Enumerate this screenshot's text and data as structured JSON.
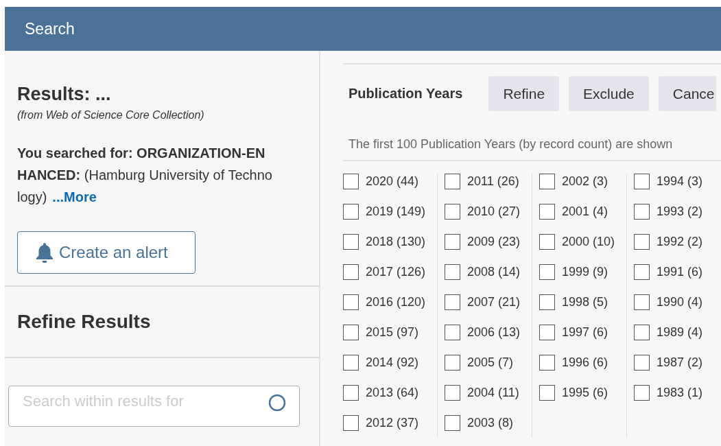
{
  "header": {
    "title": "Search"
  },
  "results": {
    "title": "Results: ...",
    "source": "(from Web of Science Core Collection)",
    "query": "**You searched for: ORGANIZATION-ENHANCED:** (Hamburg University of Technology)",
    "more_link": "...More",
    "alert_button": "Create an alert"
  },
  "refine": {
    "title": "Refine Results",
    "search_placeholder": "Search within results for"
  },
  "facet": {
    "title": "Publication Years",
    "buttons": [
      "Refine",
      "Exclude",
      "Cance"
    ],
    "info": "The first 100 Publication Years (by record count) are shown",
    "columns": [
      [
        {
          "label": "2020 (44)",
          "checked": false
        },
        {
          "label": "2019 (149)",
          "checked": false
        },
        {
          "label": "2018 (130)",
          "checked": false
        },
        {
          "label": "2017 (126)",
          "checked": false
        },
        {
          "label": "2016 (120)",
          "checked": false
        },
        {
          "label": "2015 (97)",
          "checked": false
        },
        {
          "label": "2014 (92)",
          "checked": false
        },
        {
          "label": "2013 (64)",
          "checked": false
        },
        {
          "label": "2012 (37)",
          "checked": false
        }
      ],
      [
        {
          "label": "2011 (26)",
          "checked": false
        },
        {
          "label": "2010 (27)",
          "checked": false
        },
        {
          "label": "2009 (23)",
          "checked": false
        },
        {
          "label": "2008 (14)",
          "checked": false
        },
        {
          "label": "2007 (21)",
          "checked": false
        },
        {
          "label": "2006 (13)",
          "checked": false
        },
        {
          "label": "2005 (7)",
          "checked": false
        },
        {
          "label": "2004 (11)",
          "checked": false
        },
        {
          "label": "2003 (8)",
          "checked": false
        }
      ],
      [
        {
          "label": "2002 (3)",
          "checked": false
        },
        {
          "label": "2001 (4)",
          "checked": false
        },
        {
          "label": "2000 (10)",
          "checked": false
        },
        {
          "label": "1999 (9)",
          "checked": false
        },
        {
          "label": "1998 (5)",
          "checked": false
        },
        {
          "label": "1997 (6)",
          "checked": false
        },
        {
          "label": "1996 (6)",
          "checked": false
        },
        {
          "label": "1995 (6)",
          "checked": false
        }
      ],
      [
        {
          "label": "1994 (3)",
          "checked": false
        },
        {
          "label": "1993 (2)",
          "checked": false
        },
        {
          "label": "1992 (2)",
          "checked": false
        },
        {
          "label": "1991 (6)",
          "checked": false
        },
        {
          "label": "1990 (4)",
          "checked": false
        },
        {
          "label": "1989 (4)",
          "checked": false
        },
        {
          "label": "1987 (2)",
          "checked": false
        },
        {
          "label": "1983 (1)",
          "checked": false
        }
      ]
    ]
  }
}
